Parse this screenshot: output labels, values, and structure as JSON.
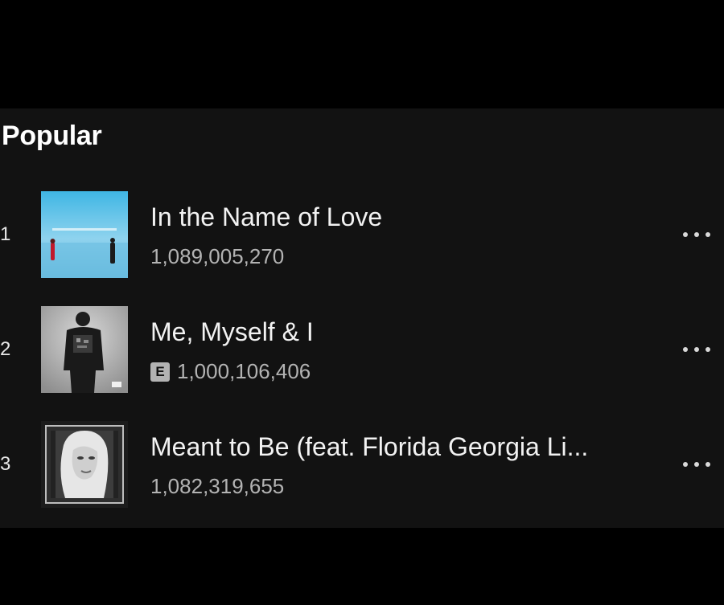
{
  "popular": {
    "title": "Popular",
    "tracks": [
      {
        "rank": "1",
        "title": "In the Name of Love",
        "plays": "1,089,005,270",
        "explicit": false,
        "cover_icon": "album-cover-image"
      },
      {
        "rank": "2",
        "title": "Me, Myself & I",
        "plays": "1,000,106,406",
        "explicit": true,
        "explicit_label": "E",
        "cover_icon": "album-cover-image"
      },
      {
        "rank": "3",
        "title": "Meant to Be (feat. Florida Georgia Li...",
        "plays": "1,082,319,655",
        "explicit": false,
        "cover_icon": "album-cover-image"
      }
    ],
    "more_icon": "more-options-icon"
  },
  "colors": {
    "background": "#000000",
    "panel": "#121212",
    "text_primary": "#ffffff",
    "text_secondary": "#b3b3b3"
  }
}
